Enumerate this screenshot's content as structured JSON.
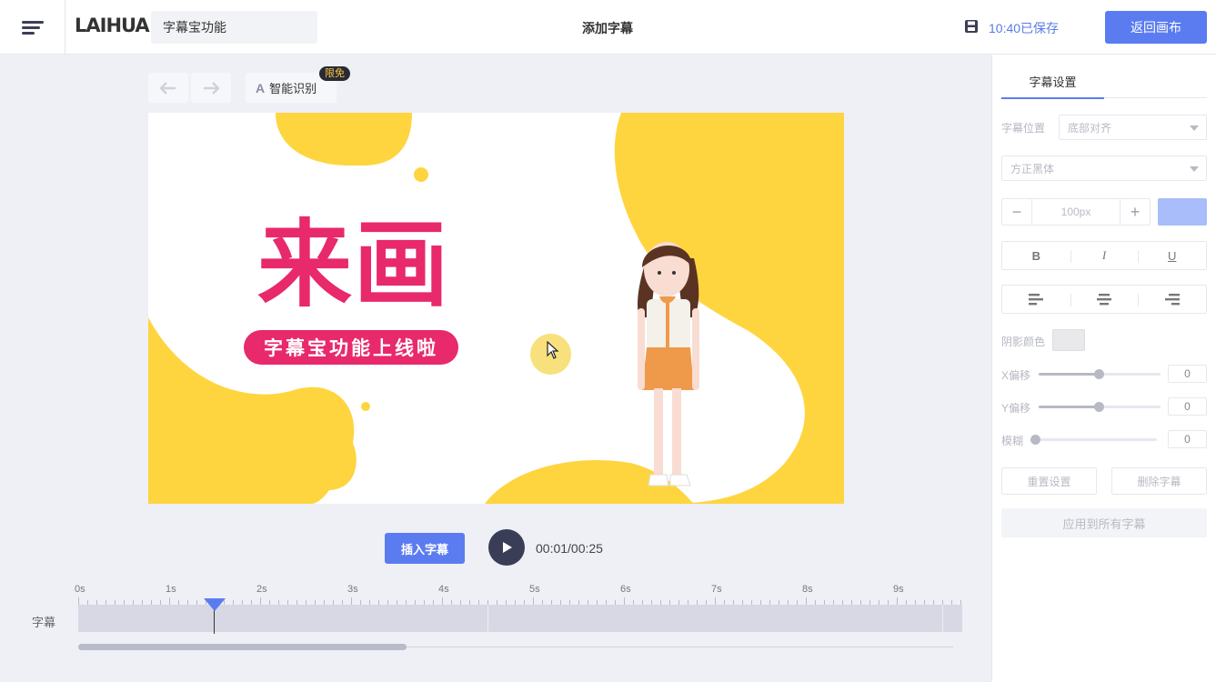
{
  "header": {
    "logo": "LAIHUA",
    "title_value": "字幕宝功能",
    "center_title": "添加字幕",
    "save_status": "10:40已保存",
    "back_button": "返回画布"
  },
  "toolbar": {
    "undo_icon": "undo-arrow-icon",
    "redo_icon": "redo-arrow-icon",
    "smart_recognize": "智能识别",
    "smart_icon_text": "A",
    "badge": "限免"
  },
  "canvas": {
    "big_title": "来画",
    "pill_text": "字幕宝功能上线啦"
  },
  "playback": {
    "insert_button": "插入字幕",
    "time": "00:01/00:25"
  },
  "timeline": {
    "labels": [
      "0s",
      "1s",
      "2s",
      "3s",
      "4s",
      "5s",
      "6s",
      "7s",
      "8s",
      "9s"
    ],
    "track_label": "字幕",
    "playhead_seconds": 1.5,
    "scroll_fraction": 0.37
  },
  "panel": {
    "tab_label": "字幕设置",
    "position_label": "字幕位置",
    "position_value": "底部对齐",
    "font_value": "方正黑体",
    "font_size": "100px",
    "minus": "−",
    "plus": "+",
    "bold": "B",
    "italic": "I",
    "underline": "U",
    "shadow_color_label": "阴影颜色",
    "x_offset_label": "X偏移",
    "x_offset_value": "0",
    "y_offset_label": "Y偏移",
    "y_offset_value": "0",
    "blur_label": "模糊",
    "blur_value": "0",
    "reset_button": "重置设置",
    "delete_button": "删除字幕",
    "apply_all_button": "应用到所有字幕"
  },
  "colors": {
    "accent": "#5b7cf0",
    "canvas_yellow": "#fed53f",
    "brand_pink": "#e8296b",
    "dark": "#3a3d56"
  }
}
